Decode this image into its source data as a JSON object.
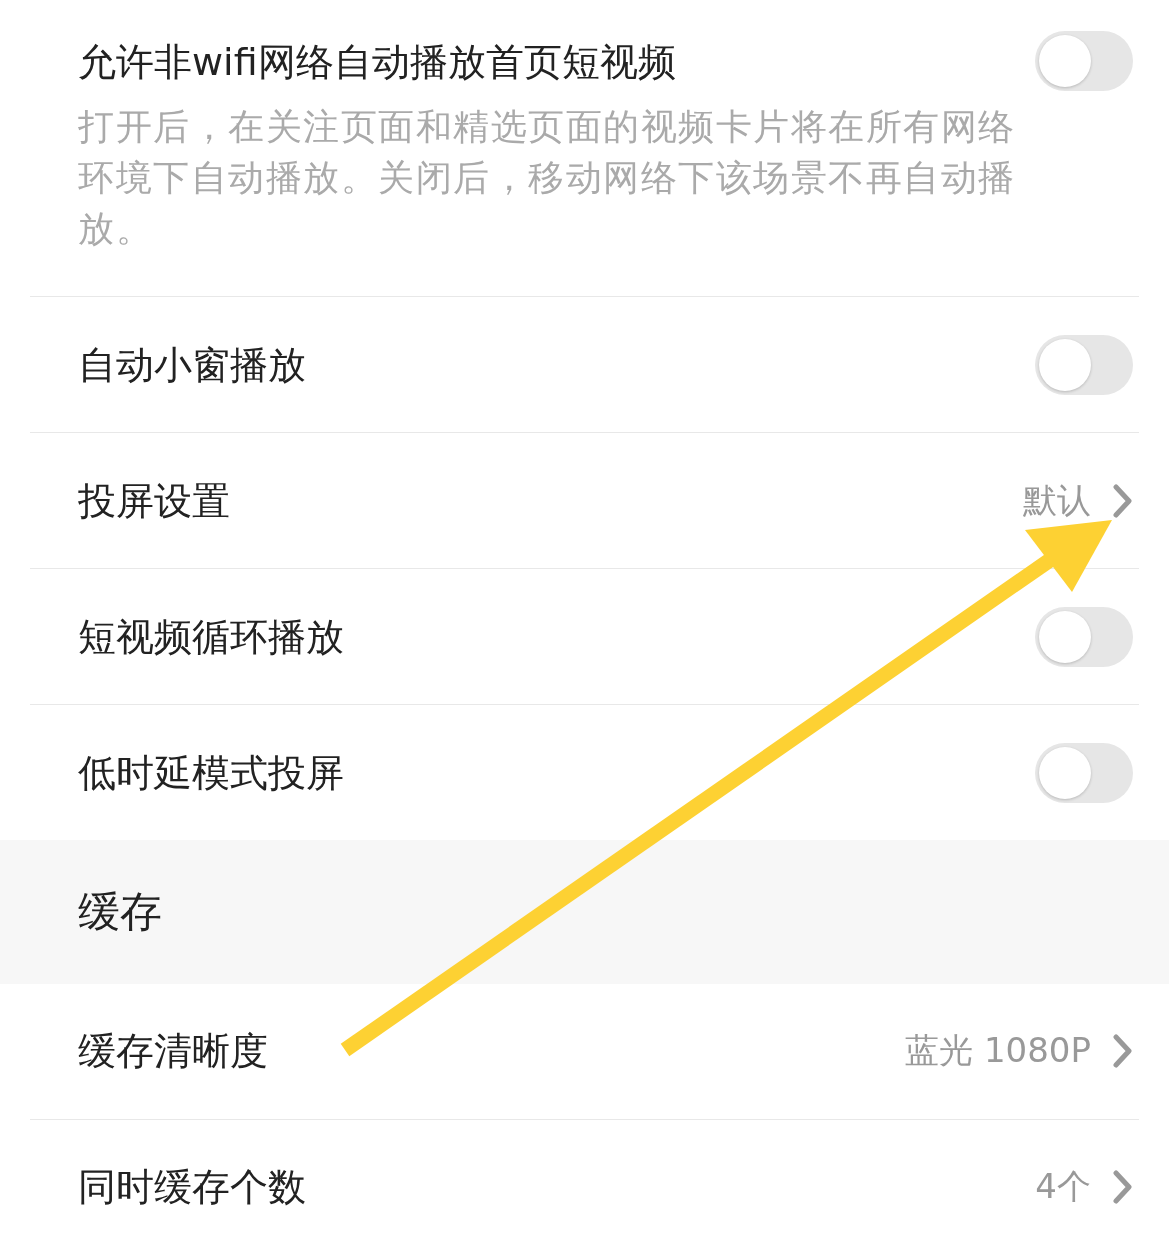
{
  "settings": [
    {
      "kind": "toggle",
      "label": "允许非wifi网络自动播放首页短视频",
      "description": "打开后，在关注页面和精选页面的视频卡片将在所有网络环境下自动播放。关闭后，移动网络下该场景不再自动播放。",
      "on": false
    },
    {
      "kind": "toggle",
      "label": "自动小窗播放",
      "on": false
    },
    {
      "kind": "link",
      "label": "投屏设置",
      "value": "默认"
    },
    {
      "kind": "toggle",
      "label": "短视频循环播放",
      "on": false
    },
    {
      "kind": "toggle",
      "label": "低时延模式投屏",
      "on": false
    },
    {
      "kind": "section",
      "label": "缓存"
    },
    {
      "kind": "link",
      "label": "缓存清晰度",
      "value": "蓝光 1080P"
    },
    {
      "kind": "link",
      "label": "同时缓存个数",
      "value": "4个"
    }
  ]
}
